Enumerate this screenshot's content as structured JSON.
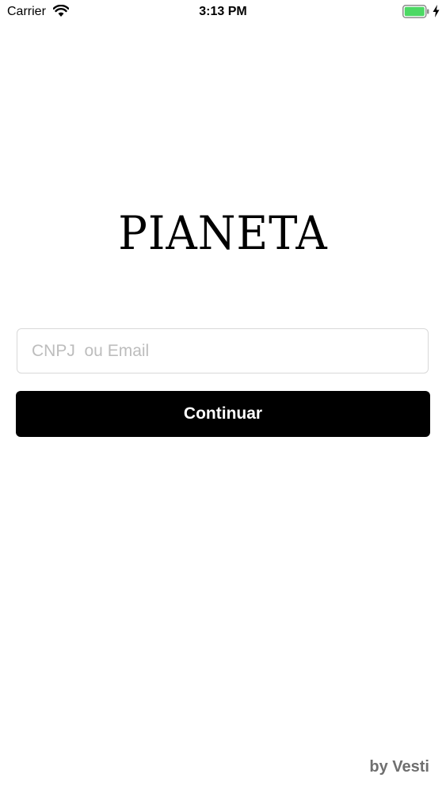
{
  "status_bar": {
    "carrier": "Carrier",
    "time": "3:13 PM",
    "battery_color": "#4cd964"
  },
  "brand": {
    "logo_text": "PIANETA"
  },
  "login": {
    "input_placeholder": "CNPJ  ou Email",
    "input_value": "",
    "continue_label": "Continuar"
  },
  "footer": {
    "credit": "by Vesti"
  },
  "colors": {
    "button_background": "#000000",
    "button_text": "#ffffff",
    "placeholder": "#bdbdbd",
    "footer_text": "#6f6f6f"
  }
}
